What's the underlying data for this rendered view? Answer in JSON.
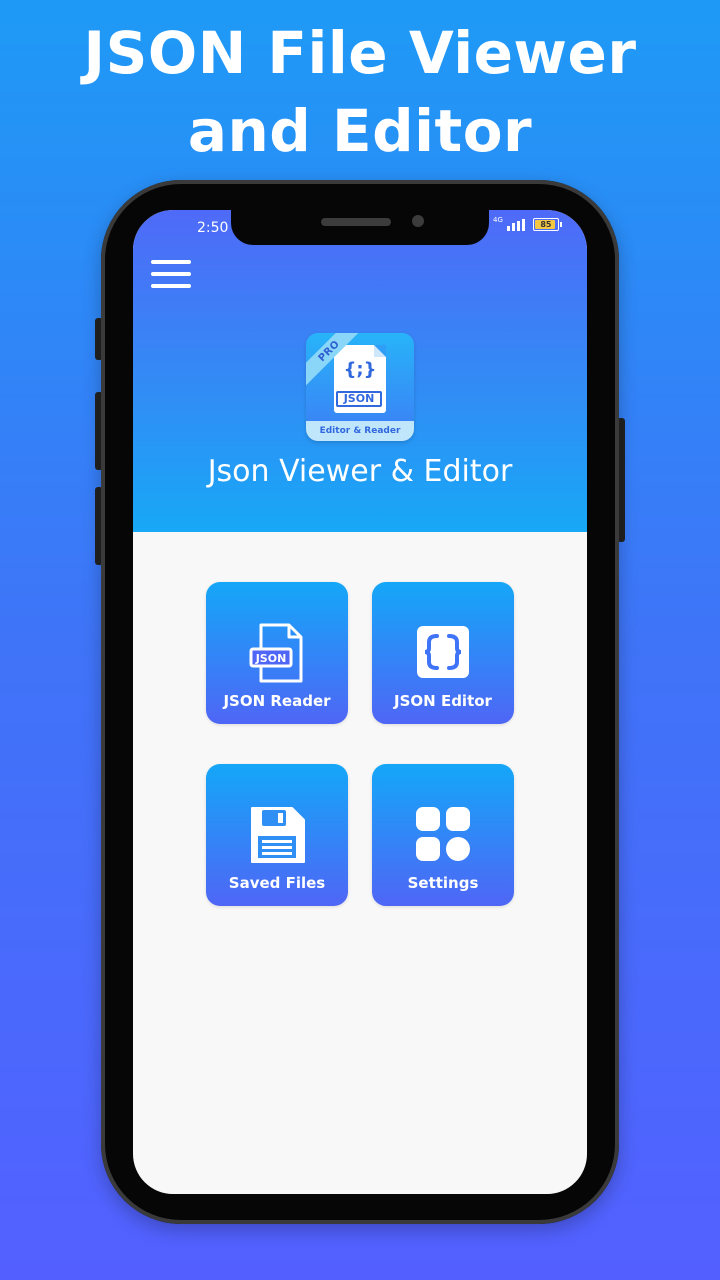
{
  "promo": {
    "title_line1": "JSON File Viewer",
    "title_line2": "and Editor"
  },
  "status_bar": {
    "time": "2:50",
    "network": "4G",
    "battery": "85"
  },
  "header": {
    "menu_icon": "hamburger-menu-icon",
    "logo": {
      "ribbon": "PRO",
      "braces": "{;}",
      "doc_label": "JSON",
      "band": "Editor & Reader"
    },
    "app_title": "Json Viewer & Editor"
  },
  "tiles": [
    {
      "label": "JSON Reader",
      "icon": "json-file-icon"
    },
    {
      "label": "JSON Editor",
      "icon": "curly-braces-icon"
    },
    {
      "label": "Saved Files",
      "icon": "floppy-disk-icon"
    },
    {
      "label": "Settings",
      "icon": "grid-settings-icon"
    }
  ],
  "colors": {
    "accent": "#4f6af8",
    "header_bottom": "#17a8f7",
    "tile_top": "#14a7f8",
    "tile_bottom": "#4f66f6",
    "content_bg": "#f8f8f8"
  }
}
